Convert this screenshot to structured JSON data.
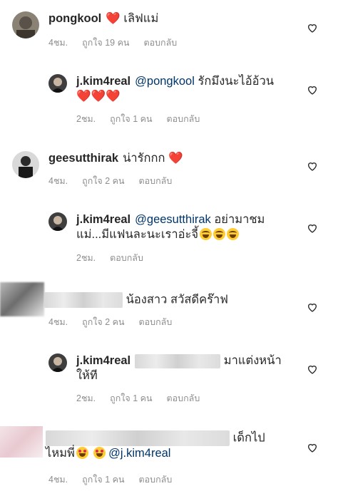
{
  "comments": [
    {
      "username": "pongkool",
      "text": "เลิฟแม่",
      "time": "4ชม.",
      "likes": "ถูกใจ 19 คน",
      "reply": "ตอบกลับ"
    },
    {
      "username": "j.kim4real",
      "mention": "@pongkool",
      "text": "รักมึงนะไอ้อ้วน",
      "time": "2ชม.",
      "likes": "ถูกใจ 1 คน",
      "reply": "ตอบกลับ"
    },
    {
      "username": "geesutthirak",
      "text": "น่ารักกก",
      "time": "4ชม.",
      "likes": "ถูกใจ 2 คน",
      "reply": "ตอบกลับ"
    },
    {
      "username": "j.kim4real",
      "mention": "@geesutthirak",
      "text": "อย่ามาชม",
      "text2": "แม่...มีแฟนละนะเราอ่ะจี้",
      "time": "2ชม.",
      "reply": "ตอบกลับ"
    },
    {
      "text": "น้องสาว สวัสดีคร๊าฟ",
      "time": "4ชม.",
      "likes": "ถูกใจ 2 คน",
      "reply": "ตอบกลับ"
    },
    {
      "username": "j.kim4real",
      "text": "มาแต่งหน้า",
      "text2": "ให้ที",
      "time": "2ชม.",
      "likes": "ถูกใจ 1 คน",
      "reply": "ตอบกลับ"
    },
    {
      "text": "เด็กไป",
      "text2": "ไหมพี่",
      "mention": "@j.kim4real",
      "time": "4ชม.",
      "likes": "ถูกใจ 1 คน",
      "reply": "ตอบกลับ"
    }
  ]
}
